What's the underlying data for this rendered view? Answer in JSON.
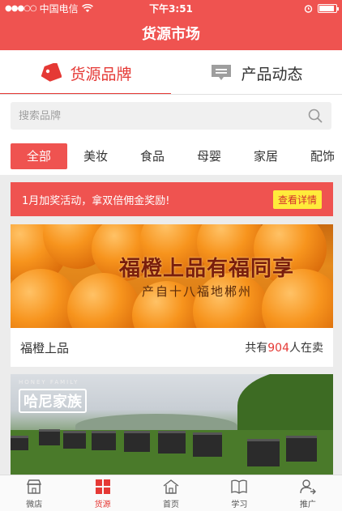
{
  "status": {
    "carrier": "中国电信",
    "time": "下午3:51"
  },
  "nav": {
    "title": "货源市场"
  },
  "segments": [
    {
      "label": "货源品牌",
      "active": true
    },
    {
      "label": "产品动态",
      "active": false
    }
  ],
  "search": {
    "placeholder": "搜索品牌"
  },
  "categories": [
    "全部",
    "美妆",
    "食品",
    "母婴",
    "家居",
    "配饰"
  ],
  "promo": {
    "text": "1月加奖活动，拿双倍佣金奖励!",
    "button": "查看详情"
  },
  "cards": [
    {
      "banner_line1": "福橙上品有福同享",
      "banner_line2": "产自十八福地郴州",
      "name": "福橙上品",
      "count_prefix": "共有",
      "count": "904",
      "count_suffix": "人在卖"
    },
    {
      "banner_small": "HONEY FAMILY",
      "banner_brand": "哈尼家族"
    }
  ],
  "tabbar": [
    {
      "label": "微店",
      "icon": "shop-icon",
      "active": false
    },
    {
      "label": "货源",
      "icon": "grid-icon",
      "active": true
    },
    {
      "label": "首页",
      "icon": "home-icon",
      "active": false
    },
    {
      "label": "学习",
      "icon": "book-icon",
      "active": false
    },
    {
      "label": "推广",
      "icon": "user-share-icon",
      "active": false
    }
  ],
  "colors": {
    "brand_red": "#ef5350",
    "promo_button": "#ffeb3b",
    "active_text": "#e53935"
  }
}
